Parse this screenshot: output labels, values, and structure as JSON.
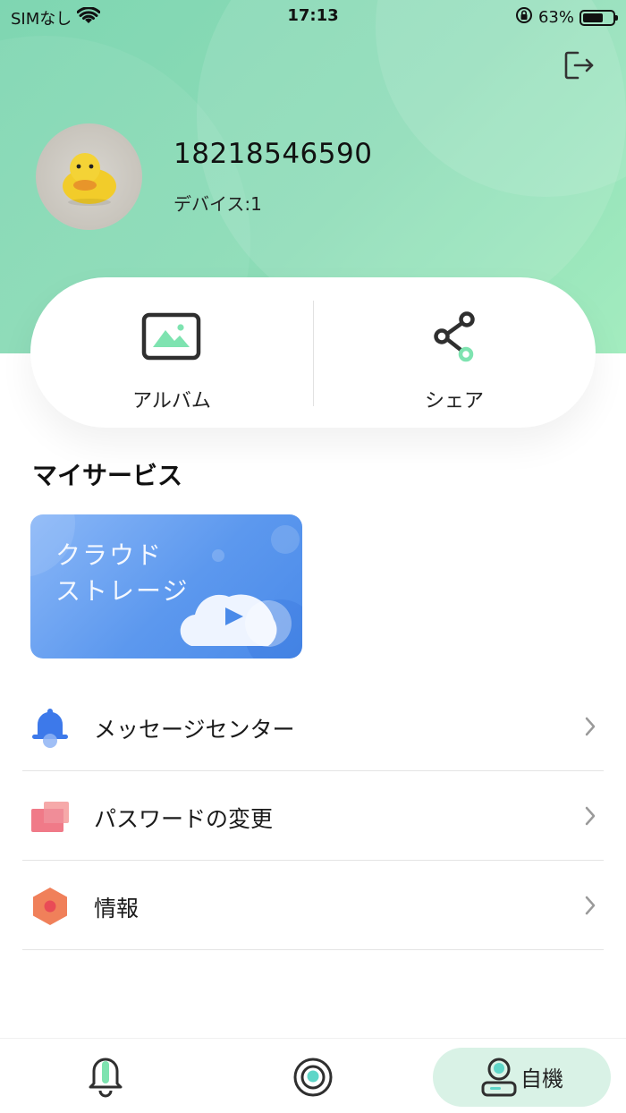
{
  "status_bar": {
    "carrier": "SIMなし",
    "time": "17:13",
    "battery_percent": "63%",
    "battery_level": 0.63
  },
  "profile": {
    "phone": "18218546590",
    "devices": "デバイス:1"
  },
  "quick_actions": [
    {
      "label": "アルバム",
      "icon": "album-icon"
    },
    {
      "label": "シェア",
      "icon": "share-icon"
    }
  ],
  "services": {
    "title": "マイサービス",
    "cloud_storage_label": "クラウド\nストレージ"
  },
  "menu": [
    {
      "label": "メッセージセンター",
      "icon": "bell-icon"
    },
    {
      "label": "パスワードの変更",
      "icon": "password-icon"
    },
    {
      "label": "情報",
      "icon": "info-hexagon-icon"
    }
  ],
  "tabbar": {
    "tabs": [
      {
        "icon": "bell-tab-icon"
      },
      {
        "icon": "camera-tab-icon"
      },
      {
        "icon": "profile-tab-icon",
        "label": "自機",
        "active": true
      }
    ]
  },
  "colors": {
    "header_green": "#8ddcb7",
    "accent_green": "#5fd49b",
    "cloud_blue": "#5c98ee",
    "active_tab_bg": "#d9f2e6"
  }
}
